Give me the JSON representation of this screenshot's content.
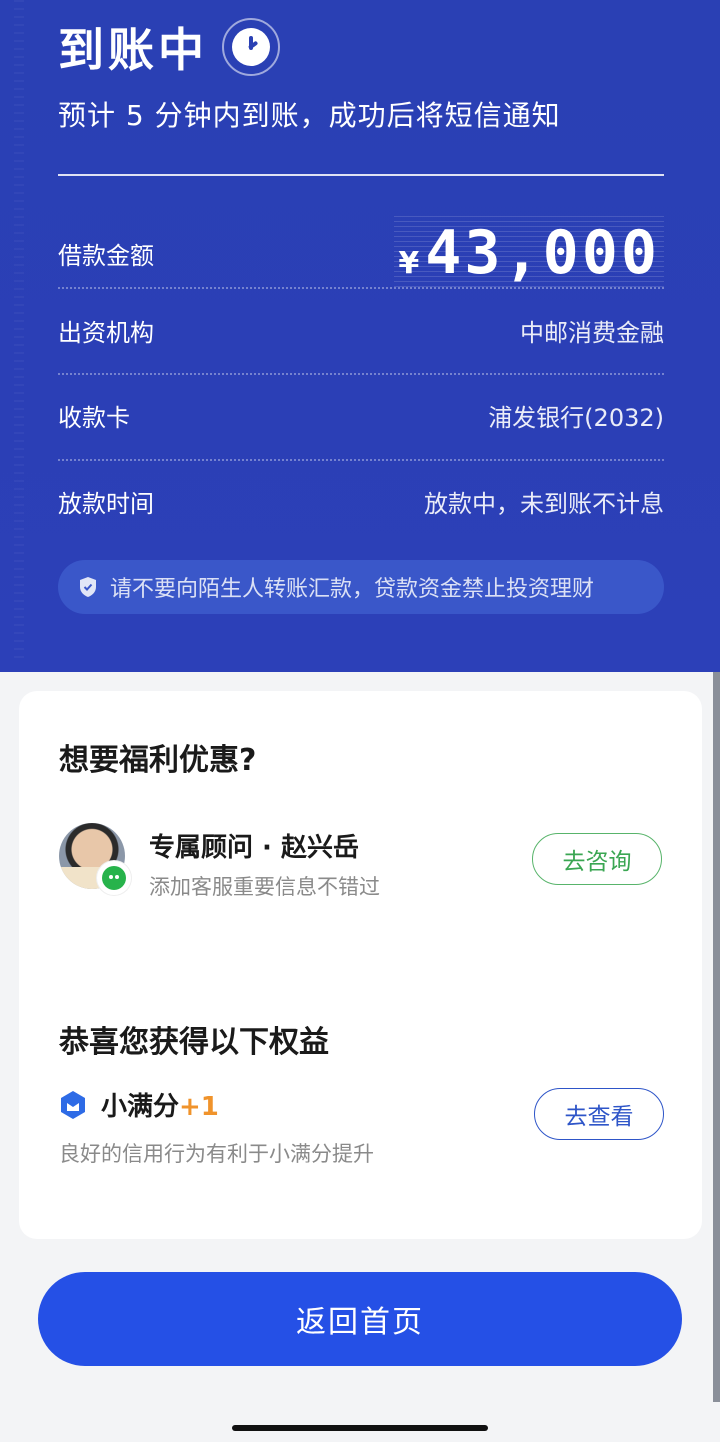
{
  "header": {
    "title": "到账中",
    "subtitle": "预计 5 分钟内到账，成功后将短信通知"
  },
  "details": {
    "amount_label": "借款金额",
    "amount_currency": "¥",
    "amount_value": "43,000",
    "funder_label": "出资机构",
    "funder_value": "中邮消费金融",
    "card_label": "收款卡",
    "card_value": "浦发银行(2032)",
    "time_label": "放款时间",
    "time_value": "放款中，未到账不计息"
  },
  "notice": "请不要向陌生人转账汇款，贷款资金禁止投资理财",
  "welfare": {
    "title": "想要福利优惠?",
    "advisor_name": "专属顾问 · 赵兴岳",
    "advisor_desc": "添加客服重要信息不错过",
    "consult_button": "去咨询"
  },
  "rights": {
    "title": "恭喜您获得以下权益",
    "name": "小满分",
    "plus": "+1",
    "desc": "良好的信用行为有利于小满分提升",
    "view_button": "去查看"
  },
  "home_button": "返回首页",
  "colors": {
    "primary_blue": "#2550e6",
    "header_blue": "#2a40b4",
    "wechat_green": "#27b34b",
    "plus_orange": "#f0932b"
  }
}
